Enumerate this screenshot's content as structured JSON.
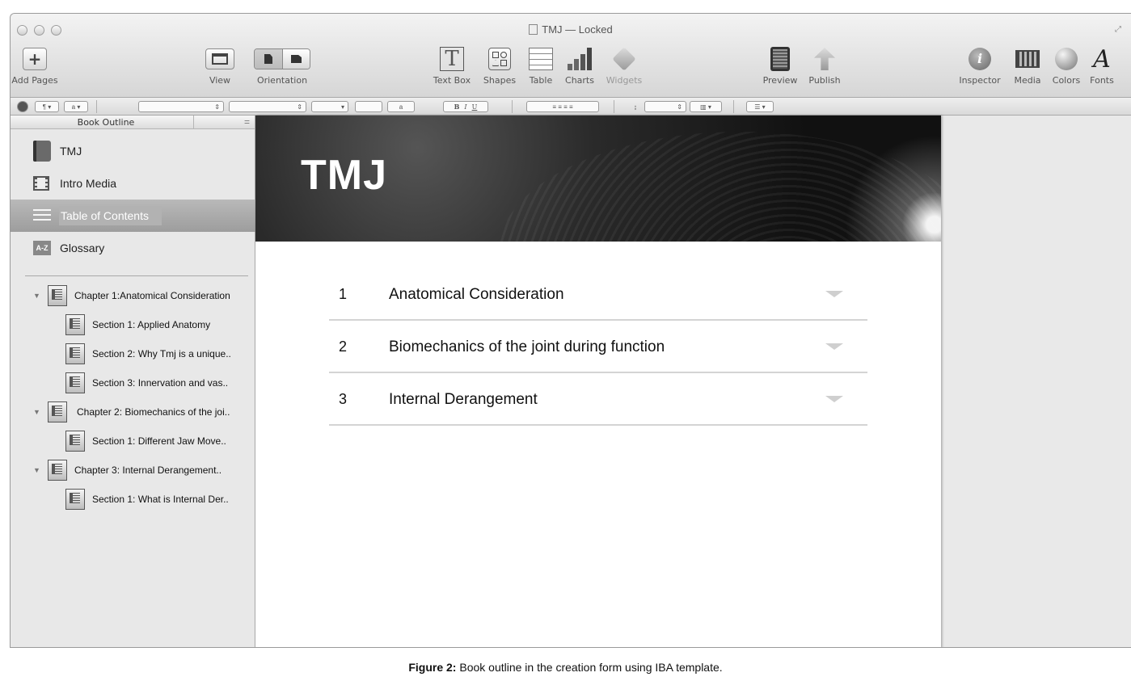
{
  "window": {
    "title": "TMJ — Locked"
  },
  "toolbar": {
    "add_pages": "Add Pages",
    "view": "View",
    "orientation": "Orientation",
    "text_box": "Text Box",
    "shapes": "Shapes",
    "table": "Table",
    "charts": "Charts",
    "widgets": "Widgets",
    "preview": "Preview",
    "publish": "Publish",
    "inspector": "Inspector",
    "media": "Media",
    "colors": "Colors",
    "fonts": "Fonts",
    "text_box_glyph": "T",
    "fonts_glyph": "A",
    "inspector_glyph": "i",
    "add_glyph": "+"
  },
  "format_bar": {
    "paragraph": "¶",
    "char": "a",
    "bold": "B",
    "italic": "I",
    "underline": "U"
  },
  "sidebar": {
    "header": "Book Outline",
    "top_items": [
      {
        "label": "TMJ",
        "icon": "book-icon"
      },
      {
        "label": "Intro Media",
        "icon": "film-icon"
      },
      {
        "label": "Table of Contents",
        "icon": "list-icon",
        "selected": true
      },
      {
        "label": "Glossary",
        "icon": "az-icon",
        "icon_text": "A-Z"
      }
    ],
    "tree": [
      {
        "label": "Chapter  1:Anatomical Consideration",
        "type": "chapter"
      },
      {
        "label": "Section 1: Applied Anatomy",
        "type": "section"
      },
      {
        "label": "Section 2: Why Tmj is a unique..",
        "type": "section"
      },
      {
        "label": "Section 3: Innervation and vas..",
        "type": "section"
      },
      {
        "label": "Chapter 2: Biomechanics of the joi..",
        "type": "chapter"
      },
      {
        "label": "Section  1: Different Jaw Move..",
        "type": "section"
      },
      {
        "label": "Chapter 3: Internal Derangement..",
        "type": "chapter"
      },
      {
        "label": "Section 1: What is Internal Der..",
        "type": "section"
      }
    ]
  },
  "page": {
    "banner_title": "TMJ",
    "toc": [
      {
        "num": "1",
        "title": "Anatomical Consideration"
      },
      {
        "num": "2",
        "title": "Biomechanics of the joint during function"
      },
      {
        "num": "3",
        "title": "Internal Derangement"
      }
    ]
  },
  "caption": {
    "label": "Figure 2:",
    "text": " Book outline in the creation form using IBA template."
  }
}
